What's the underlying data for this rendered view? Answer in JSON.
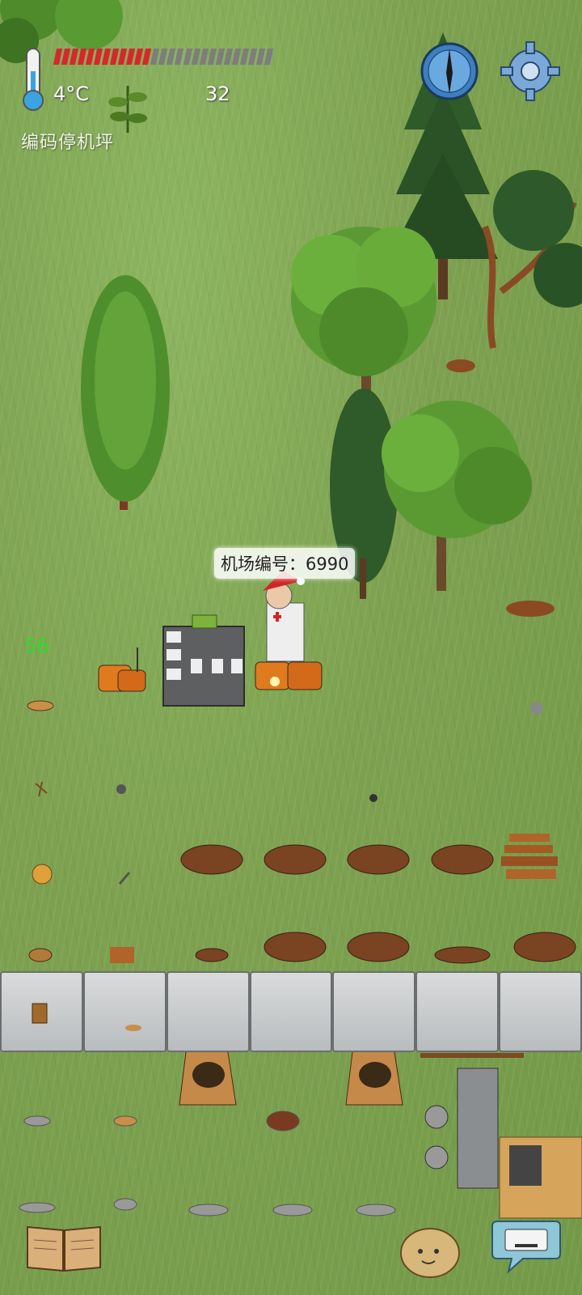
{
  "hud": {
    "temperature": "4°C",
    "age_value": "32",
    "location_label": "编码停机坪",
    "food_filled": 12,
    "food_total": 27,
    "icons": [
      "thermometer-icon",
      "herb-icon",
      "compass-icon",
      "gear-icon"
    ]
  },
  "world": {
    "player_speech": "机场编号：6990",
    "floating_number": "56"
  },
  "bottom_bar": {
    "icons": [
      "journal-book-icon",
      "emote-potato-icon",
      "keyboard-chat-icon"
    ]
  },
  "colors": {
    "grass": "#7fa456",
    "food_full": "#d8262b",
    "food_empty": "#7d7d7d",
    "speech_bg": "#ffffff",
    "counter_green": "#2bdc2b"
  }
}
